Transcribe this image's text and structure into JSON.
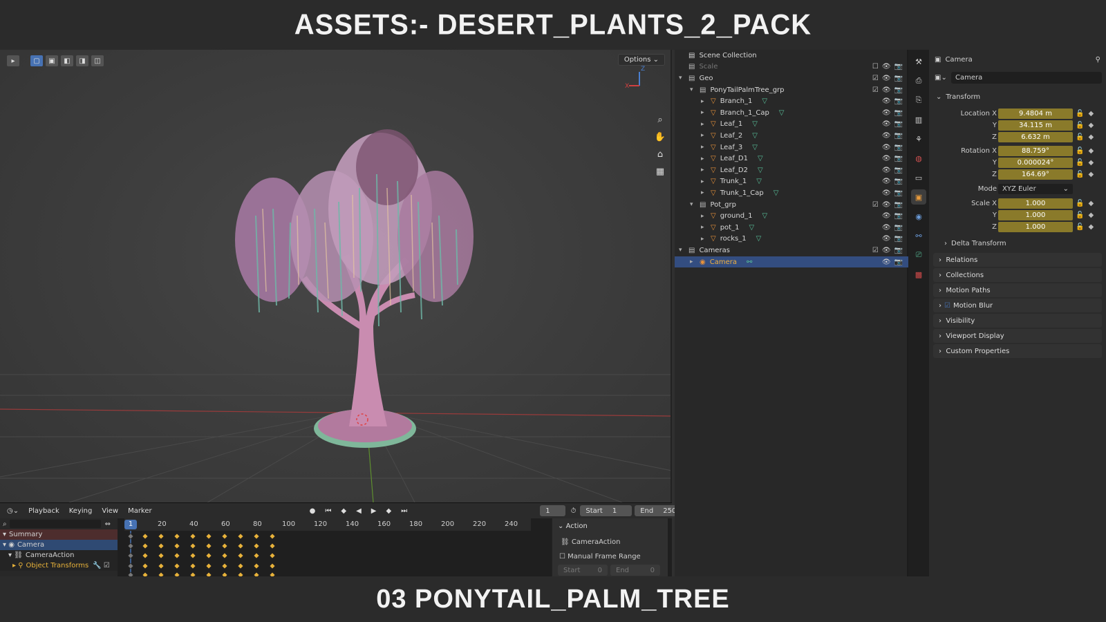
{
  "title": "ASSETS:- DESERT_PLANTS_2_PACK",
  "subtitle": "03 PONYTAIL_PALM_TREE",
  "viewport": {
    "options_label": "Options",
    "axis_x": "X",
    "axis_z": "Z"
  },
  "timeline": {
    "menus": [
      "Playback",
      "Keying",
      "View",
      "Marker"
    ],
    "current_frame": "1",
    "start_label": "Start",
    "start_value": "1",
    "end_label": "End",
    "end_value": "250",
    "ruler": [
      "20",
      "40",
      "60",
      "80",
      "100",
      "120",
      "140",
      "160",
      "180",
      "200",
      "220",
      "240"
    ],
    "ruler_current": "1",
    "channels": [
      "Summary",
      "Camera",
      "CameraAction",
      "Object Transforms"
    ],
    "action_panel": {
      "header": "Action",
      "action_name": "CameraAction",
      "manual_range": "Manual Frame Range",
      "start_label": "Start",
      "start_value": "0",
      "end_label": "End",
      "end_value": "0"
    }
  },
  "outliner": {
    "scene_collection": "Scene Collection",
    "items": [
      {
        "label": "Scale"
      },
      {
        "label": "Geo"
      },
      {
        "label": "PonyTailPalmTree_grp"
      },
      {
        "label": "Branch_1"
      },
      {
        "label": "Branch_1_Cap"
      },
      {
        "label": "Leaf_1"
      },
      {
        "label": "Leaf_2"
      },
      {
        "label": "Leaf_3"
      },
      {
        "label": "Leaf_D1"
      },
      {
        "label": "Leaf_D2"
      },
      {
        "label": "Trunk_1"
      },
      {
        "label": "Trunk_1_Cap"
      },
      {
        "label": "Pot_grp"
      },
      {
        "label": "ground_1"
      },
      {
        "label": "pot_1"
      },
      {
        "label": "rocks_1"
      },
      {
        "label": "Cameras"
      },
      {
        "label": "Camera"
      }
    ]
  },
  "properties": {
    "header": "Camera",
    "object_name": "Camera",
    "transform_label": "Transform",
    "location_label": "Location X",
    "location": [
      "9.4804 m",
      "34.115 m",
      "6.632 m"
    ],
    "rotation_label": "Rotation X",
    "rotation": [
      "88.759°",
      "0.000024°",
      "164.69°"
    ],
    "axis_y": "Y",
    "axis_z": "Z",
    "mode_label": "Mode",
    "mode_value": "XYZ Euler",
    "scale_label": "Scale X",
    "scale": [
      "1.000",
      "1.000",
      "1.000"
    ],
    "delta_transform": "Delta Transform",
    "panels": [
      "Relations",
      "Collections",
      "Motion Paths",
      "Motion Blur",
      "Visibility",
      "Viewport Display",
      "Custom Properties"
    ]
  },
  "colors": {
    "accent": "#4772b3",
    "keyframe": "#e8b23a",
    "value_field": "#8a7a2a",
    "foliage_pink": "#c78bb0",
    "foliage_teal": "#6fb8a8"
  }
}
